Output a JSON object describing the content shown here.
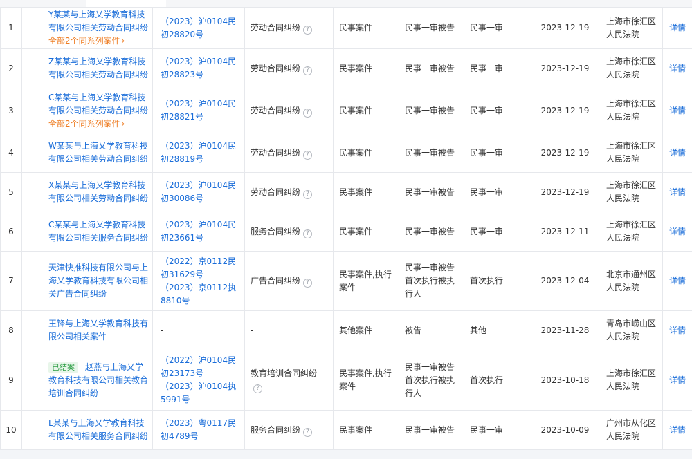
{
  "table": {
    "detail_label": "详情",
    "series_label": "全部2个同系列案件",
    "closed_badge": "已结案",
    "rows": [
      {
        "idx": "1",
        "name": "Y某某与上海乂学教育科技有限公司相关劳动合同纠纷",
        "series": true,
        "badge": false,
        "case_no": [
          "（2023）沪0104民初28820号"
        ],
        "cause": "劳动合同纠纷",
        "help": true,
        "type": "民事案件",
        "role": "民事一审被告",
        "stage": "民事一审",
        "date": "2023-12-19",
        "court": "上海市徐汇区人民法院"
      },
      {
        "idx": "2",
        "name": "Z某某与上海乂学教育科技有限公司相关劳动合同纠纷",
        "series": false,
        "badge": false,
        "case_no": [
          "（2023）沪0104民初28823号"
        ],
        "cause": "劳动合同纠纷",
        "help": true,
        "type": "民事案件",
        "role": "民事一审被告",
        "stage": "民事一审",
        "date": "2023-12-19",
        "court": "上海市徐汇区人民法院"
      },
      {
        "idx": "3",
        "name": "C某某与上海乂学教育科技有限公司相关劳动合同纠纷",
        "series": true,
        "badge": false,
        "case_no": [
          "（2023）沪0104民初28821号"
        ],
        "cause": "劳动合同纠纷",
        "help": true,
        "type": "民事案件",
        "role": "民事一审被告",
        "stage": "民事一审",
        "date": "2023-12-19",
        "court": "上海市徐汇区人民法院"
      },
      {
        "idx": "4",
        "name": "W某某与上海乂学教育科技有限公司相关劳动合同纠纷",
        "series": false,
        "badge": false,
        "case_no": [
          "（2023）沪0104民初28819号"
        ],
        "cause": "劳动合同纠纷",
        "help": true,
        "type": "民事案件",
        "role": "民事一审被告",
        "stage": "民事一审",
        "date": "2023-12-19",
        "court": "上海市徐汇区人民法院"
      },
      {
        "idx": "5",
        "name": "X某某与上海乂学教育科技有限公司相关劳动合同纠纷",
        "series": false,
        "badge": false,
        "case_no": [
          "（2023）沪0104民初30086号"
        ],
        "cause": "劳动合同纠纷",
        "help": true,
        "type": "民事案件",
        "role": "民事一审被告",
        "stage": "民事一审",
        "date": "2023-12-19",
        "court": "上海市徐汇区人民法院"
      },
      {
        "idx": "6",
        "name": "C某某与上海乂学教育科技有限公司相关服务合同纠纷",
        "series": false,
        "badge": false,
        "case_no": [
          "（2023）沪0104民初23661号"
        ],
        "cause": "服务合同纠纷",
        "help": true,
        "type": "民事案件",
        "role": "民事一审被告",
        "stage": "民事一审",
        "date": "2023-12-11",
        "court": "上海市徐汇区人民法院"
      },
      {
        "idx": "7",
        "name": "天津快推科技有限公司与上海乂学教育科技有限公司相关广告合同纠纷",
        "series": false,
        "badge": false,
        "case_no": [
          "（2022）京0112民初31629号",
          "（2023）京0112执8810号"
        ],
        "cause": "广告合同纠纷",
        "help": true,
        "type": "民事案件,执行案件",
        "role": "民事一审被告首次执行被执行人",
        "stage": "首次执行",
        "date": "2023-12-04",
        "court": "北京市通州区人民法院"
      },
      {
        "idx": "8",
        "name": "王锋与上海乂学教育科技有限公司相关案件",
        "series": false,
        "badge": false,
        "case_no": [
          "-"
        ],
        "cause": "-",
        "help": false,
        "type": "其他案件",
        "role": "被告",
        "stage": "其他",
        "date": "2023-11-28",
        "court": "青岛市崂山区人民法院"
      },
      {
        "idx": "9",
        "name": "赵燕与上海乂学教育科技有限公司相关教育培训合同纠纷",
        "series": false,
        "badge": true,
        "case_no": [
          "（2022）沪0104民初23173号",
          "（2023）沪0104执5991号"
        ],
        "cause": "教育培训合同纠纷",
        "help": true,
        "type": "民事案件,执行案件",
        "role": "民事一审被告首次执行被执行人",
        "stage": "首次执行",
        "date": "2023-10-18",
        "court": "上海市徐汇区人民法院"
      },
      {
        "idx": "10",
        "name": "L某某与上海乂学教育科技有限公司相关服务合同纠纷",
        "series": false,
        "badge": false,
        "case_no": [
          "（2023）粤0117民初4789号"
        ],
        "cause": "服务合同纠纷",
        "help": true,
        "type": "民事案件",
        "role": "民事一审被告",
        "stage": "民事一审",
        "date": "2023-10-09",
        "court": "广州市从化区人民法院"
      }
    ]
  }
}
